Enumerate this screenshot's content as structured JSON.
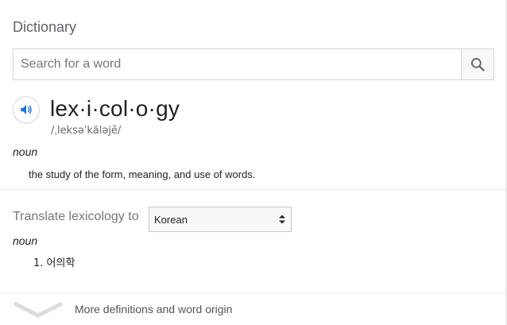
{
  "header": {
    "title": "Dictionary"
  },
  "search": {
    "placeholder": "Search for a word",
    "value": ""
  },
  "entry": {
    "headword": "lex·i·col·o·gy",
    "phonetic": "/ˌleksəˈkäləjē/",
    "part_of_speech": "noun",
    "definition": "the study of the form, meaning, and use of words."
  },
  "translate": {
    "label": "Translate lexicology to",
    "selected_language": "Korean",
    "part_of_speech": "noun",
    "items": [
      {
        "number": "1.",
        "text": "어의학"
      }
    ]
  },
  "footer": {
    "more_label": "More definitions and word origin"
  },
  "colors": {
    "speaker_blue": "#1a73e8",
    "icon_gray": "#5f6368",
    "chevron_gray": "#dadce0"
  },
  "icons": {
    "search": "search-icon",
    "speaker": "speaker-icon",
    "select_arrows": "updown-arrows-icon",
    "chevron": "chevron-down-icon"
  }
}
